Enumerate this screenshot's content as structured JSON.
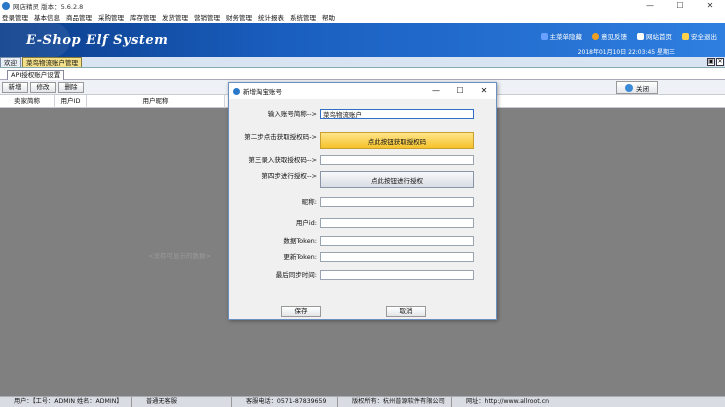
{
  "window": {
    "title": "网店精灵 版本：5.6.2.8",
    "min": "—",
    "max": "☐",
    "close": "✕"
  },
  "menu": [
    "登录管理",
    "基本信息",
    "商品管理",
    "采购管理",
    "库存管理",
    "发货管理",
    "营销管理",
    "财务管理",
    "统计报表",
    "系统管理",
    "帮助"
  ],
  "banner": {
    "logo": "E-Shop Elf System",
    "nav": [
      {
        "label": "主菜单隐藏",
        "icon": "menu-icon",
        "color": "#6aa0ff"
      },
      {
        "label": "意见反馈",
        "icon": "feedback-icon",
        "color": "#f0a020"
      },
      {
        "label": "网站首页",
        "icon": "home-icon",
        "color": "#ffffff"
      },
      {
        "label": "安全退出",
        "icon": "lock-icon",
        "color": "#ffd24a"
      }
    ],
    "clock": "2018年01月10日 22:03:45 星期三"
  },
  "tabs": [
    "欢迎",
    "菜鸟物流账户管理"
  ],
  "subtab": "API授权账户设置",
  "toolbar": {
    "add": "新增",
    "edit": "修改",
    "delete": "删除",
    "close": "关闭"
  },
  "grid": {
    "headers": [
      "卖家简称",
      "用户ID",
      "用户昵称"
    ],
    "empty": "<没有可显示的数据>"
  },
  "status": [
    "用户：【工号：ADMIN 姓名：ADMIN】",
    "普通无客服",
    "客服电话：0571-87839659",
    "版权所有：杭州普源软件有限公司",
    "网址：http://www.allroot.cn"
  ],
  "dialog": {
    "title": "新增淘宝账号",
    "min": "—",
    "max": "☐",
    "close": "✕",
    "labels": {
      "name": "输入账号简称-->",
      "step2": "第二步点击获取授权码->",
      "step3": "第三录入获取授权码-->",
      "step4": "第四步进行授权-->",
      "nick": "昵称:",
      "uid": "用户id:",
      "token": "数据Token:",
      "refresh": "更新Token:",
      "last": "最后同步时间:"
    },
    "values": {
      "name": "菜鸟物流账户",
      "code": "",
      "nick": "",
      "uid": "",
      "token": "",
      "refresh": "",
      "last": ""
    },
    "buttons": {
      "getcode": "点此按钮获取授权码",
      "auth": "点此按钮进行授权",
      "save": "保存",
      "cancel": "取消"
    }
  }
}
